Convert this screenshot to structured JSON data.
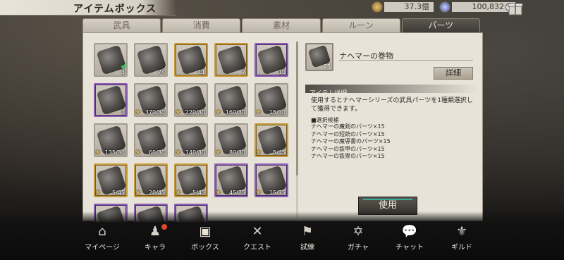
{
  "header": {
    "title": "アイテムボックス",
    "resource1": {
      "icon": "coin-icon",
      "value": "37.3億",
      "color": "#b88a3e"
    },
    "resource2": {
      "icon": "gem-icon",
      "value": "100,832",
      "color": "#7d8fc9"
    },
    "plus": "+",
    "gift_icon": "gift-icon"
  },
  "tabs": [
    {
      "label": "武具",
      "active": false
    },
    {
      "label": "消費",
      "active": false
    },
    {
      "label": "素材",
      "active": false
    },
    {
      "label": "ルーン",
      "active": false
    },
    {
      "label": "パーツ",
      "active": true
    }
  ],
  "grid": {
    "items": [
      {
        "count": "3",
        "frame": "normal",
        "selected": true
      },
      {
        "count": "74",
        "frame": "normal"
      },
      {
        "count": "11",
        "frame": "gold"
      },
      {
        "count": "7",
        "frame": "gold"
      },
      {
        "count": "10",
        "frame": "purple"
      },
      {
        "count": "1",
        "frame": "purple"
      },
      {
        "count": "370/30",
        "frame": "normal",
        "star": true
      },
      {
        "count": "220/30",
        "frame": "normal",
        "star": true
      },
      {
        "count": "160/30",
        "frame": "normal",
        "star": true
      },
      {
        "count": "15/30",
        "frame": "normal",
        "star": true
      },
      {
        "count": "135/30",
        "frame": "normal",
        "star": true
      },
      {
        "count": "60/30",
        "frame": "normal",
        "star": true
      },
      {
        "count": "140/30",
        "frame": "normal",
        "star": true
      },
      {
        "count": "80/30",
        "frame": "normal",
        "star": true
      },
      {
        "count": "5/45",
        "frame": "gold",
        "star": true
      },
      {
        "count": "5/45",
        "frame": "gold",
        "star": true
      },
      {
        "count": "20/45",
        "frame": "gold",
        "star": true
      },
      {
        "count": "5/45",
        "frame": "gold",
        "star": true
      },
      {
        "count": "45/75",
        "frame": "purple",
        "star": true
      },
      {
        "count": "15/75",
        "frame": "purple",
        "star": true
      },
      {
        "count": "",
        "frame": "purple"
      },
      {
        "count": "",
        "frame": "purple"
      },
      {
        "count": "",
        "frame": "purple"
      }
    ]
  },
  "detail": {
    "item_name": "ナヘマーの巻物",
    "item_count": "25",
    "detail_button": "詳細",
    "section_title": "アイテム詳細",
    "description": "使用するとナヘマーシリーズの武具パーツを1種類選択して獲得できます。",
    "candidates_title": "■選択候補",
    "candidates": [
      "ナヘマーの魔剣のパーツ×15",
      "ナヘマーの短銃のパーツ×15",
      "ナヘマーの魔導書のパーツ×15",
      "ナヘマーの鉄甲のパーツ×15",
      "ナヘマーの鉄冑のパーツ×15"
    ],
    "use_button": "使用"
  },
  "nav": [
    {
      "label": "マイページ",
      "icon": "home-icon",
      "glyph": "⌂",
      "active": false,
      "badge": false
    },
    {
      "label": "キャラ",
      "icon": "characters-icon",
      "glyph": "♟",
      "active": false,
      "badge": true
    },
    {
      "label": "ボックス",
      "icon": "box-icon",
      "glyph": "▣",
      "active": true,
      "badge": false
    },
    {
      "label": "クエスト",
      "icon": "crossed-swords-icon",
      "glyph": "✕",
      "active": false,
      "badge": false
    },
    {
      "label": "試練",
      "icon": "flag-icon",
      "glyph": "⚑",
      "active": false,
      "badge": false
    },
    {
      "label": "ガチャ",
      "icon": "gacha-icon",
      "glyph": "✡",
      "active": false,
      "badge": false
    },
    {
      "label": "チャット",
      "icon": "chat-icon",
      "glyph": "💬",
      "active": false,
      "badge": false
    },
    {
      "label": "ギルド",
      "icon": "guild-icon",
      "glyph": "⚜",
      "active": false,
      "badge": false
    }
  ]
}
